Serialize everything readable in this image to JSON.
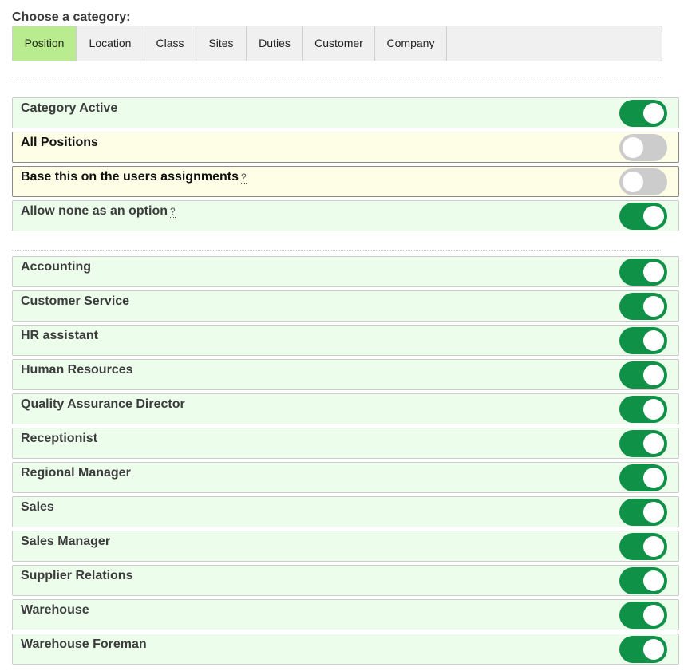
{
  "heading": "Choose a category:",
  "tabs": [
    {
      "label": "Position",
      "active": true
    },
    {
      "label": "Location",
      "active": false
    },
    {
      "label": "Class",
      "active": false
    },
    {
      "label": "Sites",
      "active": false
    },
    {
      "label": "Duties",
      "active": false
    },
    {
      "label": "Customer",
      "active": false
    },
    {
      "label": "Company",
      "active": false
    }
  ],
  "settings": [
    {
      "label": "Category Active",
      "help": "",
      "enabled": true,
      "style": "green"
    },
    {
      "label": "All Positions",
      "help": "",
      "enabled": false,
      "style": "yellow"
    },
    {
      "label": "Base this on the users assignments",
      "help": "?",
      "enabled": false,
      "style": "yellow"
    },
    {
      "label": "Allow none as an option",
      "help": "?",
      "enabled": true,
      "style": "green"
    }
  ],
  "positions": [
    {
      "label": "Accounting",
      "enabled": true
    },
    {
      "label": "Customer Service",
      "enabled": true
    },
    {
      "label": "HR assistant",
      "enabled": true
    },
    {
      "label": "Human Resources",
      "enabled": true
    },
    {
      "label": "Quality Assurance Director",
      "enabled": true
    },
    {
      "label": "Receptionist",
      "enabled": true
    },
    {
      "label": "Regional Manager",
      "enabled": true
    },
    {
      "label": "Sales",
      "enabled": true
    },
    {
      "label": "Sales Manager",
      "enabled": true
    },
    {
      "label": "Supplier Relations",
      "enabled": true
    },
    {
      "label": "Warehouse",
      "enabled": true
    },
    {
      "label": "Warehouse Foreman",
      "enabled": true
    }
  ],
  "colors": {
    "active_tab": "#b9ec8f",
    "toggle_on": "#0f9148",
    "toggle_off": "#cccccc",
    "row_green": "#ecfdec",
    "row_yellow": "#fefee6"
  }
}
